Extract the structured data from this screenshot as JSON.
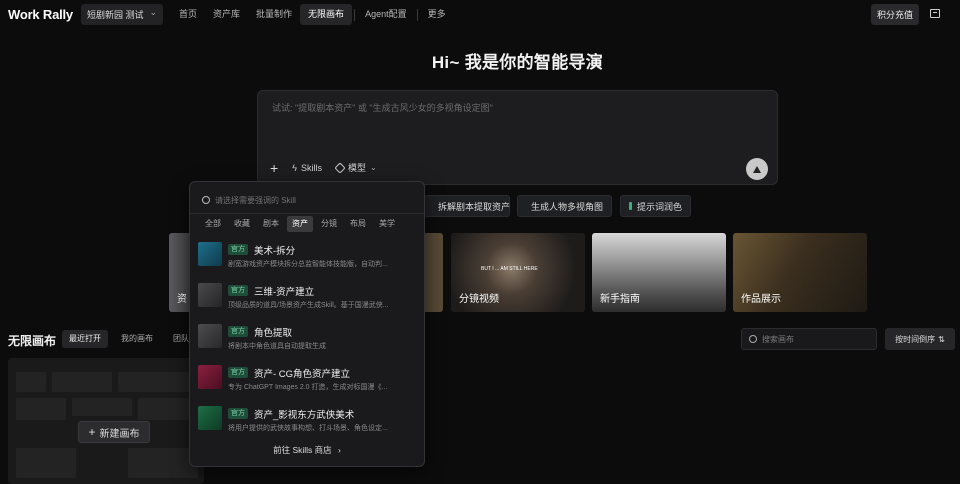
{
  "header": {
    "logo_text": "Work Rally",
    "project": "短剧新园 测试",
    "nav": [
      "首页",
      "资产库",
      "批量制作",
      "无限画布",
      "Agent配置",
      "更多"
    ],
    "active_nav": "无限画布",
    "credits_label": "积分充值"
  },
  "hero": {
    "title": "Hi~ 我是你的智能导演",
    "prompt_placeholder": "试试: \"提取剧本资产\" 或 \"生成古风少女的多视角设定图\"",
    "tools": {
      "skills": "Skills",
      "model": "模型"
    }
  },
  "chips": [
    "拆解剧本提取资产",
    "生成人物多视角图",
    "提示词润色"
  ],
  "thumbnails": [
    {
      "label": "资"
    },
    {
      "label": "分镜视频",
      "overlay": "BUT I ... AM STILL HERE"
    },
    {
      "label": "新手指南"
    },
    {
      "label": "作品展示"
    }
  ],
  "section": {
    "title": "无限画布",
    "tabs": [
      "最近打开",
      "我的画布",
      "团队画"
    ],
    "search_placeholder": "搜索画布",
    "sort_label": "按时间倒序",
    "new_canvas_label": "新建画布"
  },
  "skills_popup": {
    "search_placeholder": "请选择需要强调的 Skill",
    "tabs": [
      "全部",
      "收藏",
      "剧本",
      "资产",
      "分镜",
      "布局",
      "美学"
    ],
    "active_tab": "资产",
    "items": [
      {
        "badge": "官方",
        "name": "美术-拆分",
        "desc": "剧宽游戏资产模块拆分总监智能体技能版，自动判...",
        "color": "#1f6f8c"
      },
      {
        "badge": "官方",
        "name": "三维-资产建立",
        "desc": "顶级品质的道具/场景资产生成Skill。基于国漫武侠...",
        "color": "#3a3a3c"
      },
      {
        "badge": "官方",
        "name": "角色提取",
        "desc": "将剧本中角色道具自动提取生成",
        "color": "#3d3d40"
      },
      {
        "badge": "官方",
        "name": "资产- CG角色资产建立",
        "desc": "专为 ChatGPT Images 2.0 打造，生成对标国漫《...",
        "color": "#8c1f3f"
      },
      {
        "badge": "官方",
        "name": "资产_影视东方武侠美术",
        "desc": "将用户提供的武侠故事构想、打斗场景、角色设定...",
        "color": "#1e6e46"
      }
    ],
    "footer": "前往 Skills 商店"
  }
}
